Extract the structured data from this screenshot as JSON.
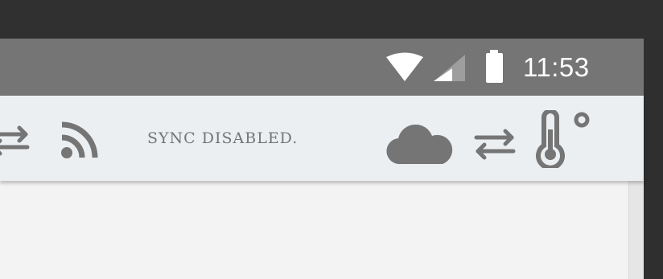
{
  "status_bar": {
    "time": "11:53",
    "icons": [
      "wifi-icon",
      "cell-signal-icon",
      "battery-icon"
    ],
    "background": "#757575"
  },
  "toolbar": {
    "sync_label": "SYNC DISABLED.",
    "left_icons": [
      "transfer-arrows-icon",
      "rss-feed-icon"
    ],
    "right_icons": [
      "cloud-icon",
      "transfer-arrows-icon",
      "thermometer-icon"
    ],
    "background": "#eceff2",
    "icon_color": "#757575"
  }
}
